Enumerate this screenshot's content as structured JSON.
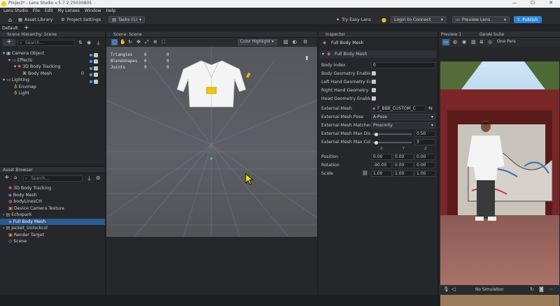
{
  "window": {
    "title": "Project* - Lens Studio v.5.7.2.25030805",
    "controls": [
      "—",
      "☐",
      "✕"
    ]
  },
  "menu": [
    "Lens Studio",
    "File",
    "Edit",
    "My Lenses",
    "Window",
    "Help"
  ],
  "toolbar": {
    "asset_library": "Asset Library",
    "project_settings": "Project Settings",
    "tasks": "Tasks (1)",
    "try_easy_lens": "Try Easy Lens",
    "login": "Login to Connect",
    "preview_lens": "Preview Lens",
    "publish": "Publish"
  },
  "layout_tab": "Default",
  "scene_hierarchy": {
    "title": "Scene Hierarchy: Scene",
    "search_placeholder": "Search...",
    "items": [
      {
        "label": "Camera Object",
        "indent": 0
      },
      {
        "label": "Effects",
        "indent": 1
      },
      {
        "label": "3D Body Tracking",
        "indent": 2
      },
      {
        "label": "Body Mesh",
        "indent": 3,
        "badge": "0"
      },
      {
        "label": "Lighting",
        "indent": 0
      },
      {
        "label": "Envmap",
        "indent": 1
      },
      {
        "label": "Light",
        "indent": 1
      }
    ]
  },
  "asset_browser": {
    "title": "Asset Browser",
    "search_placeholder": "Search...",
    "items": [
      {
        "label": "3D Body Tracking",
        "selected": false
      },
      {
        "label": "Body Mesh",
        "selected": false
      },
      {
        "label": "bodyLinesCH",
        "selected": false
      },
      {
        "label": "Device Camera Texture",
        "selected": false
      },
      {
        "label": "Echopark",
        "selected": false
      },
      {
        "label": "Full Body Mesh",
        "selected": true
      },
      {
        "label": "Jacket_Unlockcol",
        "selected": false
      },
      {
        "label": "Render Target",
        "selected": false
      },
      {
        "label": "Scene",
        "selected": false
      }
    ]
  },
  "scene_view": {
    "title": "Scene: Scene",
    "stats": [
      {
        "label": "Triangles",
        "a": "0",
        "b": "0"
      },
      {
        "label": "Blendshapes",
        "a": "0",
        "b": "0"
      },
      {
        "label": "Joints",
        "a": "0",
        "b": "0"
      }
    ],
    "display_mode": "Color Highlight"
  },
  "inspector": {
    "title": "Inspector",
    "object_name": "Full Body Mesh",
    "section": "Full Body Mesh",
    "body_index_label": "Body Index",
    "body_index": "0",
    "checks": [
      "Body Geometry Enable",
      "Left Hand Geometry En",
      "Right Hand Geometry E",
      "Head Geometry Enable"
    ],
    "external_mesh_label": "External Mesh",
    "external_mesh": "F_BBB_CUSTOM_C",
    "external_mesh_pose_label": "External Mesh Pose",
    "external_mesh_pose": "A-Pose",
    "external_mesh_matches_label": "External Mesh Matches",
    "external_mesh_matches": "Proximity",
    "max_dist_label": "External Mesh Max Dist",
    "max_dist": "0.50",
    "max_dist_frac": 0.1,
    "max_col_label": "External Mesh Max Col",
    "max_col": "3",
    "max_col_frac": 0.1,
    "axis": [
      "X",
      "Y",
      "Z"
    ],
    "position_label": "Position",
    "position": [
      "0.00",
      "0.00",
      "0.00"
    ],
    "rotation_label": "Rotation",
    "rotation": [
      "-90.00",
      "0.00",
      "0.00"
    ],
    "scale_label": "Scale",
    "scale": [
      "1.00",
      "1.00",
      "1.00"
    ]
  },
  "preview": {
    "title": "Preview 1",
    "genai_title": "GenAI Suite",
    "camera": "One Pers",
    "simulation": "No Simulation"
  },
  "colors": {
    "accent": "#2d84d6",
    "selection": "#2a5b8f",
    "bg": "#26272b"
  }
}
